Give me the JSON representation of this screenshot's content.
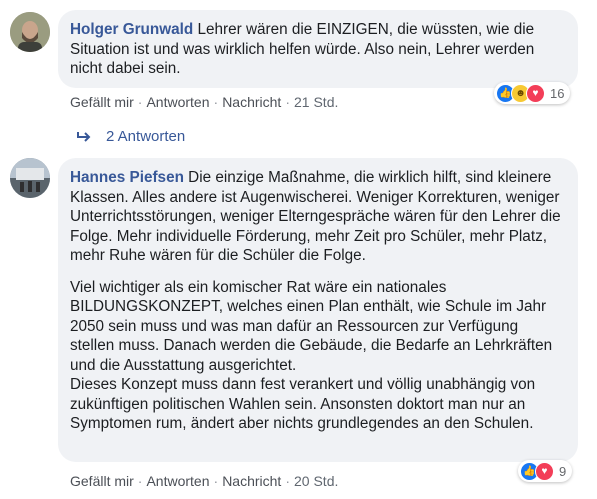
{
  "comments": [
    {
      "author": "Holger Grunwald",
      "paragraphs": [
        "Lehrer wären die EINZIGEN, die wüssten, wie die Situation ist und was wirklich helfen würde. Also nein, Lehrer werden nicht dabei sein."
      ],
      "actions": {
        "like": "Gefällt mir",
        "reply": "Antworten",
        "message": "Nachricht",
        "time": "21 Std."
      },
      "reactions": {
        "icons": [
          "like-icon",
          "haha-icon",
          "love-icon"
        ],
        "count": "16"
      },
      "replies_label": "2 Antworten"
    },
    {
      "author": "Hannes Piefsen",
      "paragraphs": [
        "Die einzige Maßnahme, die wirklich hilft, sind kleinere Klassen. Alles andere ist Augenwischerei. Weniger Korrekturen, weniger Unterrichtsstörungen, weniger Elterngespräche wären für den Lehrer die Folge. Mehr individuelle Förderung, mehr Zeit pro Schüler, mehr Platz, mehr Ruhe wären für die Schüler die Folge.",
        "Viel wichtiger als ein komischer Rat wäre ein nationales BILDUNGSKONZEPT, welches einen Plan enthält, wie Schule im Jahr 2050 sein muss und was man dafür an Ressourcen zur Verfügung stellen muss. Danach werden die Gebäude, die Bedarfe an Lehrkräften und die Ausstattung ausgerichtet.",
        "Dieses Konzept muss dann fest verankert und völlig unabhängig von zukünftigen politischen Wahlen sein. Ansonsten doktort man nur an Symptomen rum, ändert aber nichts grundlegendes an den Schulen."
      ],
      "actions": {
        "like": "Gefällt mir",
        "reply": "Antworten",
        "message": "Nachricht",
        "time": "20 Std."
      },
      "reactions": {
        "icons": [
          "like-icon",
          "love-icon"
        ],
        "count": "9"
      }
    }
  ]
}
